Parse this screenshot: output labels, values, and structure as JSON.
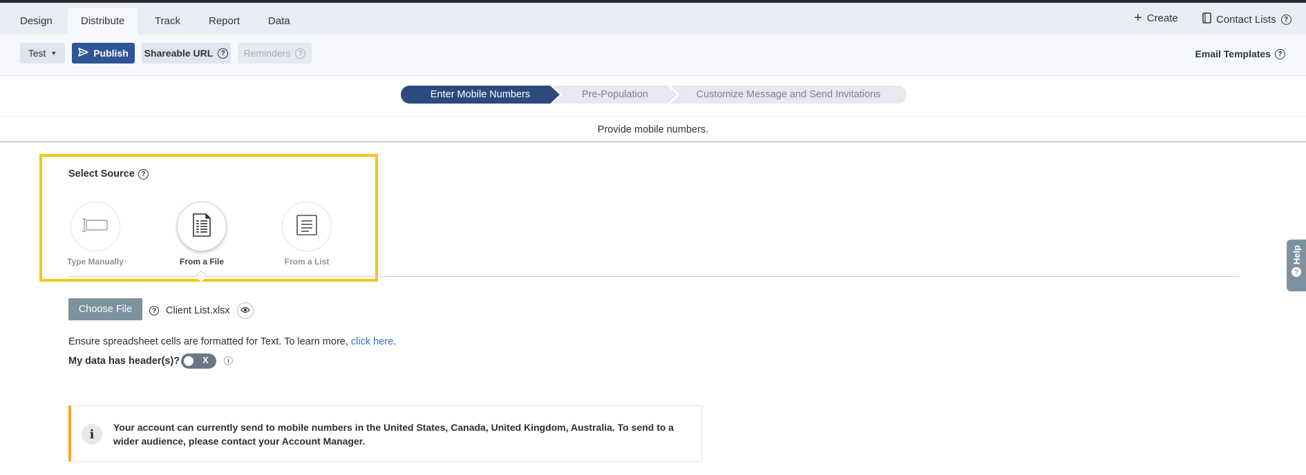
{
  "nav": {
    "tabs": [
      {
        "label": "Design"
      },
      {
        "label": "Distribute"
      },
      {
        "label": "Track"
      },
      {
        "label": "Report"
      },
      {
        "label": "Data"
      }
    ],
    "create_label": "Create",
    "contact_lists_label": "Contact Lists"
  },
  "toolbar": {
    "test_label": "Test",
    "publish_label": "Publish",
    "shareable_url_label": "Shareable URL",
    "reminders_label": "Reminders",
    "email_templates_label": "Email Templates"
  },
  "steps": [
    {
      "label": "Enter Mobile Numbers",
      "state": "active"
    },
    {
      "label": "Pre-Population",
      "state": "inactive"
    },
    {
      "label": "Customize Message and Send Invitations",
      "state": "inactive"
    }
  ],
  "subheading": "Provide mobile numbers.",
  "source": {
    "title": "Select Source",
    "options": [
      {
        "label": "Type Manually",
        "icon": "text-input-icon",
        "selected": false
      },
      {
        "label": "From a File",
        "icon": "spreadsheet-file-icon",
        "selected": true
      },
      {
        "label": "From a List",
        "icon": "list-icon",
        "selected": false
      }
    ]
  },
  "file": {
    "choose_label": "Choose File",
    "filename": "Client List.xlsx"
  },
  "hint": {
    "text": "Ensure spreadsheet cells are formatted for Text. To learn more, ",
    "link": "click here",
    "end": "."
  },
  "headers": {
    "question": "My data has header(s)?",
    "toggle_label": "X",
    "info_glyph": "i"
  },
  "notice": {
    "text": "Your account can currently send to mobile numbers in the United States, Canada, United Kingdom, Australia. To send to a wider audience, please contact your Account Manager.",
    "icon_glyph": "i"
  },
  "help": {
    "label": "Help"
  },
  "colors": {
    "primary": "#2f5597",
    "step_active": "#2c4a7e",
    "highlight": "#f5c518",
    "notice_accent": "#f5a623",
    "link": "#2d6fc7"
  }
}
